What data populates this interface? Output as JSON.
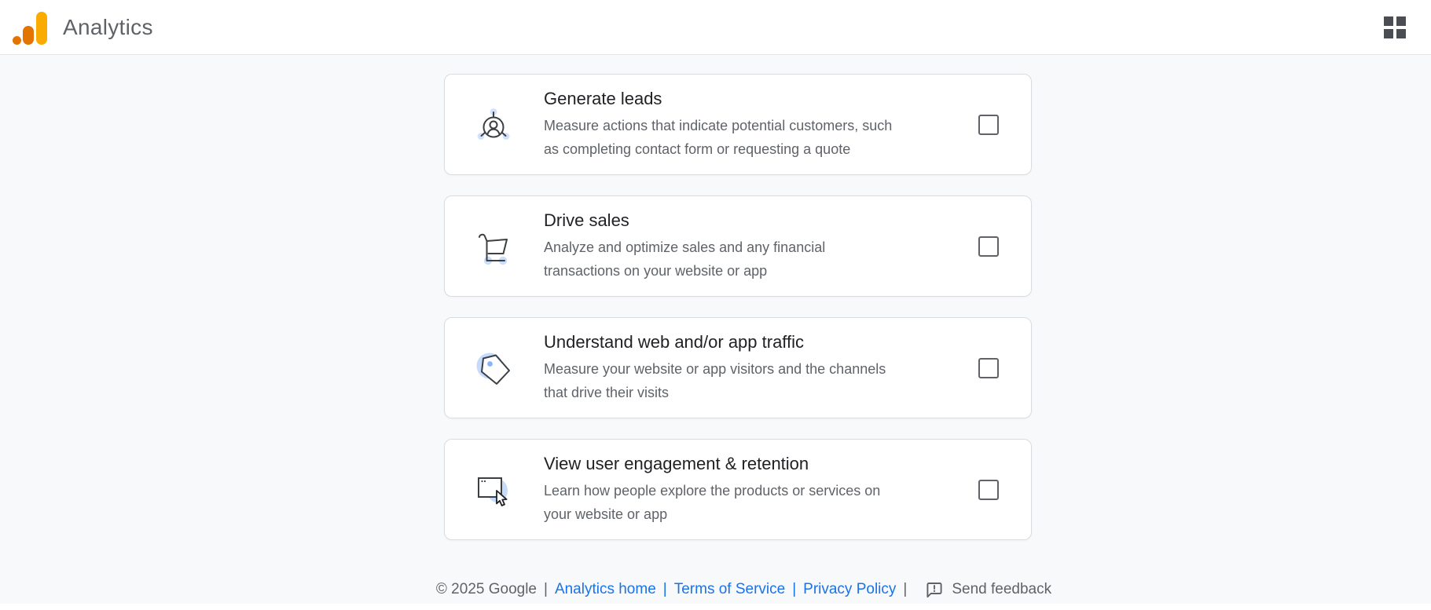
{
  "header": {
    "app_title": "Analytics",
    "logo_icon": "google-analytics-logo",
    "apps_icon": "apps-grid-icon"
  },
  "objectives": [
    {
      "title": "Generate leads",
      "description": "Measure actions that indicate potential customers, such\nas completing contact form or requesting a quote",
      "icon": "leads-person-network-icon",
      "checked": false
    },
    {
      "title": "Drive sales",
      "description": "Analyze and optimize sales and any financial\ntransactions on your website or app",
      "icon": "shopping-cart-icon",
      "checked": false
    },
    {
      "title": "Understand web and/or app traffic",
      "description": "Measure your website or app visitors and the channels\nthat drive their visits",
      "icon": "price-tag-icon",
      "checked": false
    },
    {
      "title": "View user engagement & retention",
      "description": "Learn how people explore the products or services on\nyour website or app",
      "icon": "window-cursor-icon",
      "checked": false
    }
  ],
  "footer": {
    "copyright": "© 2025 Google",
    "separator": "|",
    "links": [
      "Analytics home",
      "Terms of Service",
      "Privacy Policy"
    ],
    "feedback_label": "Send feedback",
    "feedback_icon": "feedback-bubble-icon"
  },
  "colors": {
    "page_background": "#f8f9fa",
    "card_border": "#dadce0",
    "text_primary": "#202124",
    "text_secondary": "#5f6368",
    "link_blue": "#1a73e8",
    "icon_stroke": "#3c4043",
    "icon_accent_blue": "#c6dafc",
    "icon_accent_blue_soft": "#aecbfa",
    "logo_orange": "#e37400",
    "logo_amber": "#f9ab00"
  }
}
